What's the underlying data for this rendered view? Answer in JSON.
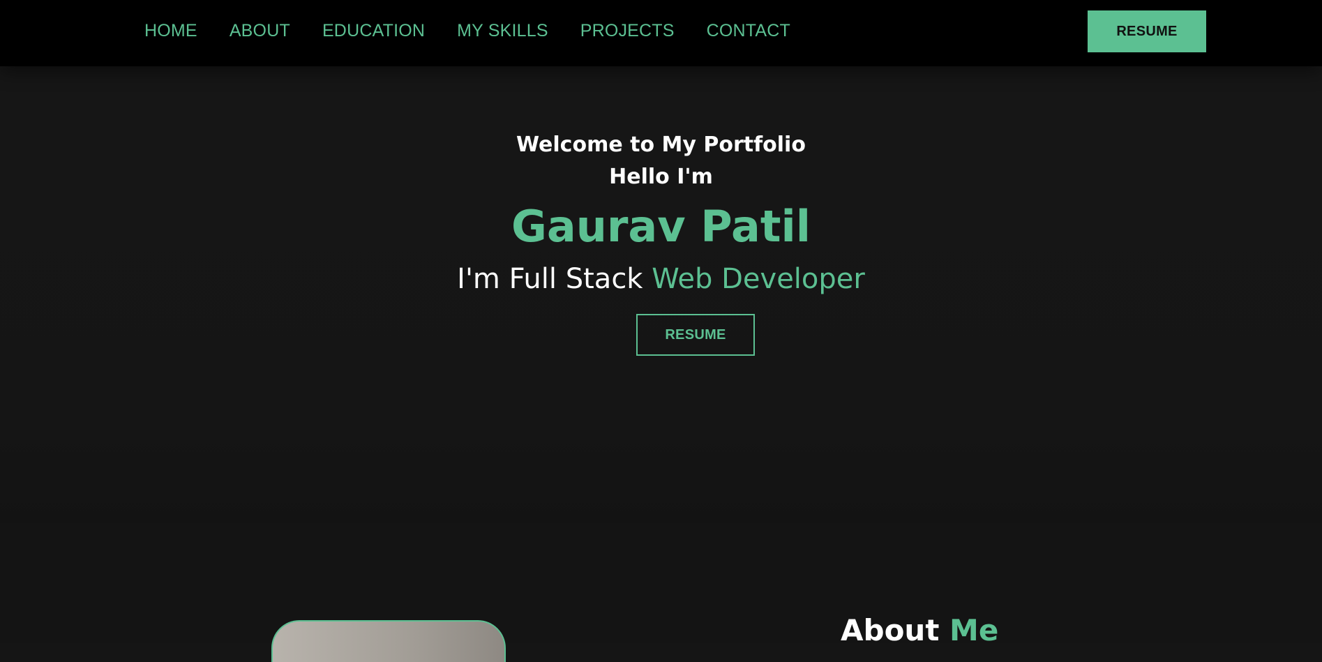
{
  "nav": {
    "links": [
      "HOME",
      "ABOUT",
      "EDUCATION",
      "MY SKILLS",
      "PROJECTS",
      "CONTACT"
    ],
    "resume_label": "RESUME"
  },
  "hero": {
    "welcome": "Welcome to My Portfolio",
    "hello": "Hello I'm",
    "name": "Gaurav Patil",
    "tagline_prefix": "I'm Full Stack",
    "tagline_highlight": "Web Developer",
    "resume_label": "RESUME"
  },
  "about": {
    "title_main": "About",
    "title_accent": "Me"
  },
  "colors": {
    "accent": "#5cc092",
    "navbar_bg": "#000000",
    "page_bg": "#151515",
    "text": "#ffffff"
  }
}
